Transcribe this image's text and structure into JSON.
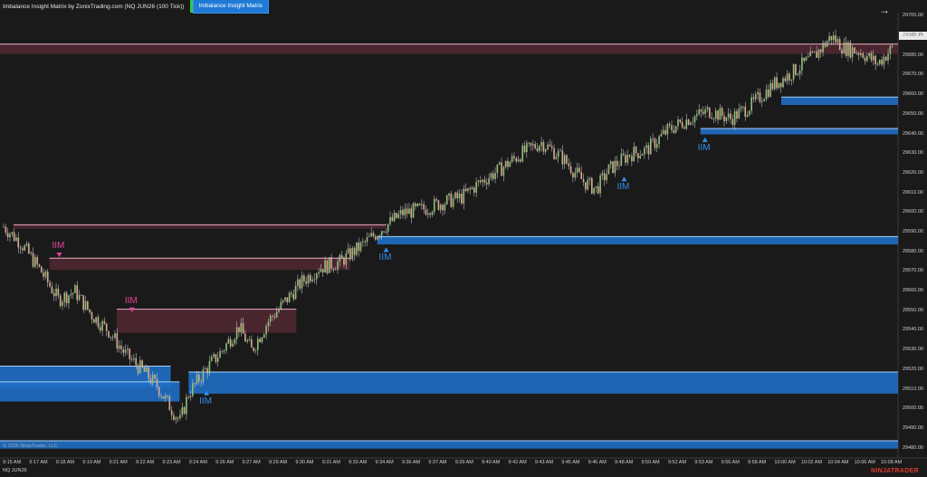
{
  "header": {
    "title": "Imbalance Insight Matrix by ZonixTrading.com (NQ JUN26 (100 Tick))",
    "indicator_button": "Imbalance Insight Matrix"
  },
  "arrow_icon": "arrow-right-icon",
  "footer": {
    "instrument": "NQ JUN26",
    "copyright": "© 2026 NinjaTrader, LLC",
    "brand": "NINJATRADER"
  },
  "colors": {
    "background": "#1a1a1a",
    "bull_candle": "#8fbf7a",
    "bear_candle": "#d9a890",
    "bull_zone": "#1f6fc4",
    "bear_zone": "#5a2a35",
    "bear_marker": "#e8459a",
    "bull_marker": "#2f8fe8",
    "brand": "#e03a2a"
  },
  "chart_data": {
    "type": "candlestick",
    "title": "Imbalance Insight Matrix by ZonixTrading.com (NQ JUN26 (100 Tick))",
    "last_price": "29685.75",
    "y_ticks": [
      "29700.00",
      "29690.00",
      "29680.00",
      "29670.00",
      "29660.00",
      "29650.00",
      "29640.00",
      "29630.00",
      "29620.00",
      "29610.00",
      "29600.00",
      "29590.00",
      "29580.00",
      "29570.00",
      "29560.00",
      "29550.00",
      "29540.00",
      "29530.00",
      "29520.00",
      "29510.00",
      "29500.00",
      "29490.00",
      "29480.00"
    ],
    "ylim": [
      29478,
      29702
    ],
    "x_ticks": [
      "9:15 AM",
      "9:17 AM",
      "9:18 AM",
      "9:19 AM",
      "9:21 AM",
      "9:22 AM",
      "9:23 AM",
      "9:24 AM",
      "9:26 AM",
      "9:27 AM",
      "9:29 AM",
      "9:30 AM",
      "9:31 AM",
      "9:33 AM",
      "9:34 AM",
      "9:36 AM",
      "9:37 AM",
      "9:39 AM",
      "9:40 AM",
      "9:42 AM",
      "9:43 AM",
      "9:45 AM",
      "9:46 AM",
      "9:48 AM",
      "9:50 AM",
      "9:52 AM",
      "9:53 AM",
      "9:56 AM",
      "9:58 AM",
      "10:00 AM",
      "10:02 AM",
      "10:04 AM",
      "10:06 AM",
      "10:08 AM"
    ],
    "price_path": [
      [
        0,
        29593
      ],
      [
        8,
        29585
      ],
      [
        18,
        29570
      ],
      [
        26,
        29556
      ],
      [
        34,
        29560
      ],
      [
        42,
        29548
      ],
      [
        50,
        29540
      ],
      [
        58,
        29528
      ],
      [
        66,
        29520
      ],
      [
        73,
        29512
      ],
      [
        80,
        29500
      ],
      [
        84,
        29494
      ],
      [
        88,
        29508
      ],
      [
        96,
        29520
      ],
      [
        104,
        29530
      ],
      [
        112,
        29542
      ],
      [
        118,
        29530
      ],
      [
        126,
        29545
      ],
      [
        134,
        29555
      ],
      [
        142,
        29565
      ],
      [
        150,
        29572
      ],
      [
        160,
        29575
      ],
      [
        170,
        29583
      ],
      [
        180,
        29592
      ],
      [
        190,
        29600
      ],
      [
        200,
        29602
      ],
      [
        208,
        29605
      ],
      [
        218,
        29608
      ],
      [
        226,
        29615
      ],
      [
        236,
        29622
      ],
      [
        246,
        29630
      ],
      [
        256,
        29636
      ],
      [
        266,
        29628
      ],
      [
        276,
        29616
      ],
      [
        282,
        29612
      ],
      [
        288,
        29622
      ],
      [
        298,
        29630
      ],
      [
        306,
        29632
      ],
      [
        316,
        29642
      ],
      [
        326,
        29648
      ],
      [
        336,
        29652
      ],
      [
        346,
        29648
      ],
      [
        356,
        29655
      ],
      [
        366,
        29665
      ],
      [
        376,
        29672
      ],
      [
        386,
        29680
      ],
      [
        394,
        29690
      ],
      [
        400,
        29684
      ],
      [
        408,
        29682
      ],
      [
        416,
        29676
      ],
      [
        424,
        29685
      ]
    ],
    "x_span": 424,
    "zones": [
      {
        "dir": "bear",
        "top": 29686,
        "bottom": 29681,
        "from": 0,
        "to": 1.0
      },
      {
        "dir": "bear",
        "top": 29594,
        "bottom": 29592,
        "from": 0.015,
        "to": 0.43
      },
      {
        "dir": "bear",
        "top": 29577,
        "bottom": 29571,
        "from": 0.055,
        "to": 0.39
      },
      {
        "dir": "bear",
        "top": 29551,
        "bottom": 29539,
        "from": 0.13,
        "to": 0.33
      },
      {
        "dir": "bull",
        "top": 29588,
        "bottom": 29584,
        "from": 0.42,
        "to": 1.0
      },
      {
        "dir": "bull",
        "top": 29659,
        "bottom": 29655,
        "from": 0.87,
        "to": 1.0
      },
      {
        "dir": "bull",
        "top": 29643,
        "bottom": 29640,
        "from": 0.78,
        "to": 1.0
      },
      {
        "dir": "bull",
        "top": 29522,
        "bottom": 29511,
        "from": 0.0,
        "to": 0.19
      },
      {
        "dir": "bull",
        "top": 29514,
        "bottom": 29504,
        "from": 0.0,
        "to": 0.2
      },
      {
        "dir": "bull",
        "top": 29519,
        "bottom": 29508,
        "from": 0.21,
        "to": 1.0
      },
      {
        "dir": "bull",
        "top": 29484,
        "bottom": 29480,
        "from": 0.0,
        "to": 1.0
      }
    ],
    "markers": [
      {
        "label": "IIM",
        "dir": "bear",
        "price": 29578,
        "at": 0.066
      },
      {
        "label": "IIM",
        "dir": "bear",
        "price": 29550,
        "at": 0.147
      },
      {
        "label": "IIM",
        "dir": "bull",
        "price": 29509,
        "at": 0.23
      },
      {
        "label": "IIM",
        "dir": "bull",
        "price": 29582,
        "at": 0.43
      },
      {
        "label": "IIM",
        "dir": "bull",
        "price": 29618,
        "at": 0.695
      },
      {
        "label": "IIM",
        "dir": "bull",
        "price": 29638,
        "at": 0.785
      }
    ]
  }
}
